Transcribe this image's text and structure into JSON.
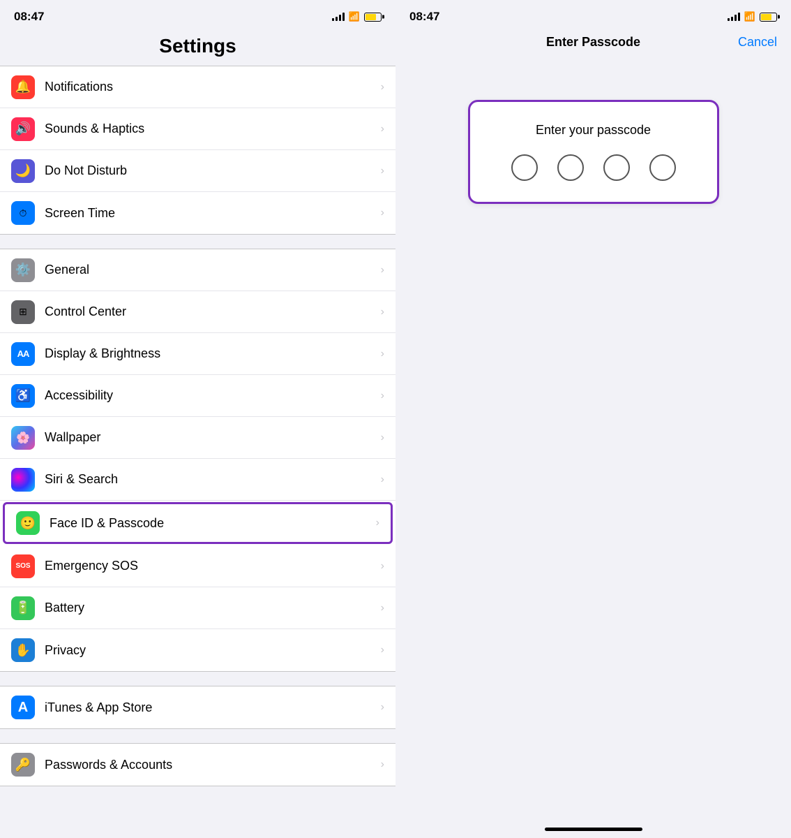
{
  "left": {
    "status": {
      "time": "08:47"
    },
    "page_title": "Settings",
    "groups": [
      {
        "id": "group1",
        "items": [
          {
            "id": "notifications",
            "label": "Notifications",
            "icon_color": "icon-red",
            "icon_char": "🔔",
            "highlighted": false
          },
          {
            "id": "sounds",
            "label": "Sounds & Haptics",
            "icon_color": "icon-pink",
            "icon_char": "🔊",
            "highlighted": false
          },
          {
            "id": "donotdisturb",
            "label": "Do Not Disturb",
            "icon_color": "icon-purple-dark",
            "icon_char": "🌙",
            "highlighted": false
          },
          {
            "id": "screentime",
            "label": "Screen Time",
            "icon_color": "icon-blue-screen",
            "icon_char": "⏱",
            "highlighted": false
          }
        ]
      },
      {
        "id": "group2",
        "items": [
          {
            "id": "general",
            "label": "General",
            "icon_color": "icon-gray",
            "icon_char": "⚙️",
            "highlighted": false
          },
          {
            "id": "controlcenter",
            "label": "Control Center",
            "icon_color": "icon-gray2",
            "icon_char": "🎛",
            "highlighted": false
          },
          {
            "id": "displaybrightness",
            "label": "Display & Brightness",
            "icon_color": "icon-blue-aa",
            "icon_char": "AA",
            "highlighted": false
          },
          {
            "id": "accessibility",
            "label": "Accessibility",
            "icon_color": "icon-blue",
            "icon_char": "♿",
            "highlighted": false
          },
          {
            "id": "wallpaper",
            "label": "Wallpaper",
            "icon_color": "icon-teal",
            "icon_char": "🌸",
            "highlighted": false
          },
          {
            "id": "sirisearch",
            "label": "Siri & Search",
            "icon_color": "siri-icon",
            "icon_char": "◎",
            "highlighted": false
          },
          {
            "id": "faceid",
            "label": "Face ID & Passcode",
            "icon_color": "icon-face",
            "icon_char": "🙂",
            "highlighted": true
          },
          {
            "id": "emergencysos",
            "label": "Emergency SOS",
            "icon_color": "icon-sos",
            "icon_char": "SOS",
            "highlighted": false
          },
          {
            "id": "battery",
            "label": "Battery",
            "icon_color": "icon-battery",
            "icon_char": "🔋",
            "highlighted": false
          },
          {
            "id": "privacy",
            "label": "Privacy",
            "icon_color": "icon-privacy",
            "icon_char": "✋",
            "highlighted": false
          }
        ]
      },
      {
        "id": "group3",
        "items": [
          {
            "id": "itunes",
            "label": "iTunes & App Store",
            "icon_color": "icon-blue-store",
            "icon_char": "A",
            "highlighted": false
          }
        ]
      },
      {
        "id": "group4",
        "items": [
          {
            "id": "passwords",
            "label": "Passwords & Accounts",
            "icon_color": "icon-gray-pass",
            "icon_char": "🔑",
            "highlighted": false
          }
        ]
      }
    ]
  },
  "right": {
    "status": {
      "time": "08:47"
    },
    "nav": {
      "title": "Enter Passcode",
      "cancel": "Cancel"
    },
    "passcode": {
      "prompt": "Enter your passcode",
      "dots_count": 4
    }
  }
}
